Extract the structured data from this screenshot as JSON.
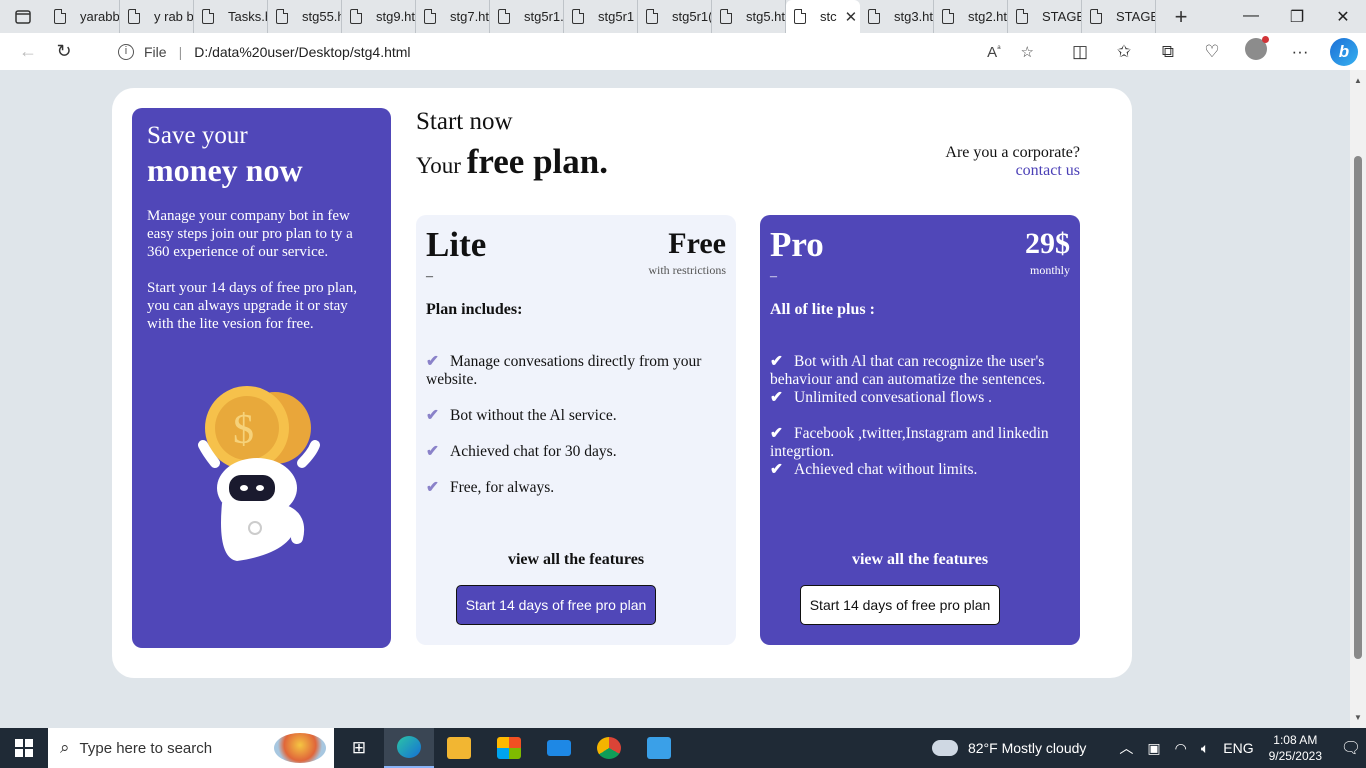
{
  "browser": {
    "tabs": [
      {
        "label": "yarabb"
      },
      {
        "label": "y rab b"
      },
      {
        "label": "Tasks.h"
      },
      {
        "label": "stg55.h"
      },
      {
        "label": "stg9.ht"
      },
      {
        "label": "stg7.ht"
      },
      {
        "label": "stg5r1."
      },
      {
        "label": "stg5r1"
      },
      {
        "label": "stg5r1("
      },
      {
        "label": "stg5.ht"
      },
      {
        "label": "stc",
        "active": true
      },
      {
        "label": "stg3.ht"
      },
      {
        "label": "stg2.ht"
      },
      {
        "label": "STAGE"
      },
      {
        "label": "STAGE"
      }
    ],
    "url_scheme_label": "File",
    "url": "D:/data%20user/Desktop/stg4.html"
  },
  "page": {
    "left_panel": {
      "heading_line1": "Save your",
      "heading_line2": "money now",
      "paragraph1": "Manage your company bot in few easy steps join our pro plan to ty a 360 experience of our service.",
      "paragraph2": "Start your 14 days of free pro plan, you can always upgrade it or stay with the lite vesion for free."
    },
    "headline": {
      "line1": "Start now",
      "line2_prefix": "Your",
      "line2_bold": "free plan."
    },
    "corporate": {
      "question": "Are you a corporate?",
      "link": "contact us"
    },
    "plans": {
      "lite": {
        "name": "Lite",
        "price": "Free",
        "price_note": "with restrictions",
        "dash": "–",
        "includes": "Plan includes:",
        "features": [
          "Manage convesations directly from your website.",
          "Bot without the Al service.",
          "Achieved chat for 30 days.",
          "Free, for always."
        ],
        "view_all": "view all the features",
        "cta": "Start 14 days of free pro plan"
      },
      "pro": {
        "name": "Pro",
        "price": "29$",
        "price_note": "monthly",
        "dash": "–",
        "includes": "All of lite plus :",
        "features": [
          "Bot with Al that can recognize the user's behaviour and can automatize the sentences.",
          "Unlimited convesational flows .",
          "Facebook ,twitter,Instagram and linkedin integrtion.",
          "Achieved chat without limits."
        ],
        "view_all": "view all the features",
        "cta": "Start 14 days of free pro plan"
      }
    }
  },
  "taskbar": {
    "search_placeholder": "Type here to search",
    "weather": "82°F  Mostly cloudy",
    "language": "ENG",
    "time": "1:08 AM",
    "date": "9/25/2023"
  },
  "colors": {
    "accent": "#5047b8",
    "link": "#4a3fb6",
    "page_bg": "#dfe5ea"
  }
}
